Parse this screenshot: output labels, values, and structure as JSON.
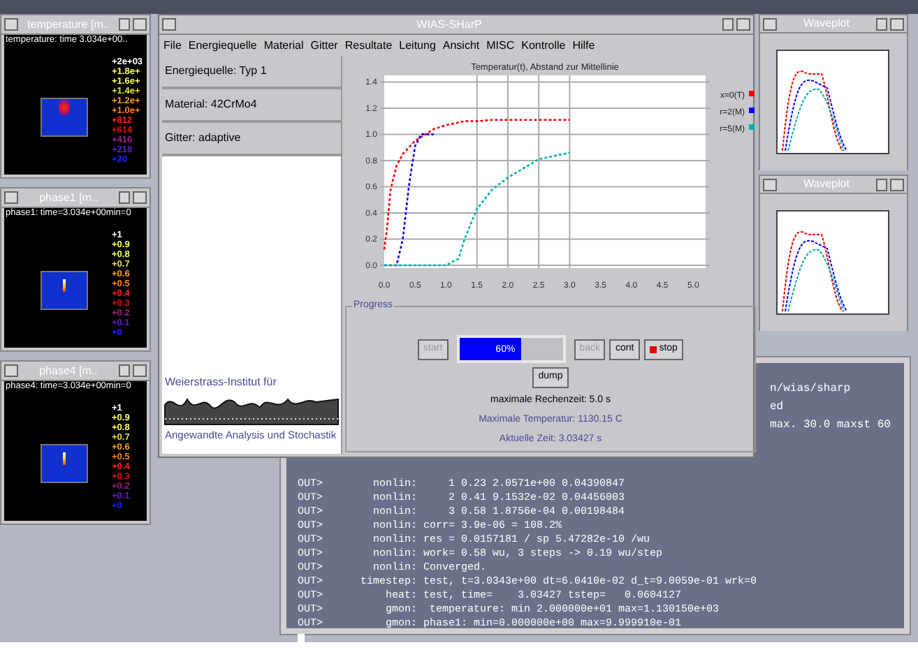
{
  "left_windows": [
    {
      "kind": "temperature",
      "title": "temperature [m..",
      "caption": "temperature: time 3.034e+00..",
      "legend": [
        {
          "label": "+2e+03",
          "color": "#ffffff"
        },
        {
          "label": "+1.8e+",
          "color": "#ffff60"
        },
        {
          "label": "+1.6e+",
          "color": "#ffff60"
        },
        {
          "label": "+1.4e+",
          "color": "#e0e040"
        },
        {
          "label": "+1.2e+",
          "color": "#ffa020"
        },
        {
          "label": "+1.0e+",
          "color": "#ff8020"
        },
        {
          "label": "+812",
          "color": "#ff2020"
        },
        {
          "label": "+614",
          "color": "#e01010"
        },
        {
          "label": "+416",
          "color": "#a02080"
        },
        {
          "label": "+218",
          "color": "#6020c0"
        },
        {
          "label": "+20",
          "color": "#2020ff"
        }
      ]
    },
    {
      "kind": "phase",
      "title": "phase1 [m..",
      "caption": "phase1: time=3.034e+00min=0",
      "legend": [
        {
          "label": "+1",
          "color": "#ffffff"
        },
        {
          "label": "+0.9",
          "color": "#ffff60"
        },
        {
          "label": "+0.8",
          "color": "#ffff60"
        },
        {
          "label": "+0.7",
          "color": "#e0e040"
        },
        {
          "label": "+0.6",
          "color": "#ffa020"
        },
        {
          "label": "+0.5",
          "color": "#ff8020"
        },
        {
          "label": "+0.4",
          "color": "#ff2020"
        },
        {
          "label": "+0.3",
          "color": "#e01010"
        },
        {
          "label": "+0.2",
          "color": "#a02080"
        },
        {
          "label": "+0.1",
          "color": "#6020c0"
        },
        {
          "label": "+0",
          "color": "#2020ff"
        }
      ]
    },
    {
      "kind": "phase",
      "title": "phase4 [m..",
      "caption": "phase4: time=3.034e+00min=0",
      "legend": [
        {
          "label": "+1",
          "color": "#ffffff"
        },
        {
          "label": "+0.9",
          "color": "#ffff60"
        },
        {
          "label": "+0.8",
          "color": "#ffff60"
        },
        {
          "label": "+0.7",
          "color": "#e0e040"
        },
        {
          "label": "+0.6",
          "color": "#ffa020"
        },
        {
          "label": "+0.5",
          "color": "#ff8020"
        },
        {
          "label": "+0.4",
          "color": "#ff2020"
        },
        {
          "label": "+0.3",
          "color": "#e01010"
        },
        {
          "label": "+0.2",
          "color": "#a02080"
        },
        {
          "label": "+0.1",
          "color": "#6020c0"
        },
        {
          "label": "+0",
          "color": "#2020ff"
        }
      ]
    }
  ],
  "terminal": {
    "partial_lines": [
      "n/wias/sharp",
      "ed",
      "max. 30.0 maxst 60"
    ],
    "lines": [
      "OUT>        nonlin:     1 0.23 2.0571e+00 0.04390847",
      "OUT>        nonlin:     2 0.41 9.1532e-02 0.04456003",
      "OUT>        nonlin:     3 0.58 1.8756e-04 0.00198484",
      "OUT>        nonlin: corr= 3.9e-06 = 108.2%",
      "OUT>        nonlin: res = 0.0157181 / sp 5.47282e-10 /wu",
      "OUT>        nonlin: work= 0.58 wu, 3 steps -> 0.19 wu/step",
      "OUT>        nonlin: Converged.",
      "OUT>      timestep: test, t=3.0343e+00 dt=6.0410e-02 d_t=9.0059e-01 wrk=0",
      "OUT>          heat: test, time=    3.03427 tstep=   0.0604127",
      "OUT>          gmon:  temperature: min 2.000000e+01 max=1.130150e+03",
      "OUT>          gmon: phase1: min=0.000000e+00 max=9.999910e-01"
    ]
  },
  "main_window": {
    "title": "WIAS-SHarP",
    "menu": [
      "File",
      "Energiequelle",
      "Material",
      "Gitter",
      "Resultate",
      "Leitung",
      "Ansicht",
      "MISC",
      "Kontrolle",
      "Hilfe"
    ],
    "info_fields": [
      "Energiequelle: Typ 1",
      "Material: 42CrMo4",
      "Gitter: adaptive"
    ],
    "logo": {
      "top_text": "Weierstrass-Institut für",
      "bottom_text": "Angewandte Analysis und Stochastik"
    },
    "chart_data": {
      "type": "line",
      "title": "Temperatur(t), Abstand zur Mittellinie",
      "xlim": [
        0,
        5.2
      ],
      "ylim": [
        0,
        1.45
      ],
      "xticks": [
        {
          "value": 0,
          "label": "0.0"
        },
        0.5,
        {
          "value": 1,
          "label": "1.0"
        },
        1.5,
        {
          "value": 2,
          "label": "2.0"
        },
        2.5,
        {
          "value": 3,
          "label": "3.0"
        },
        3.5,
        {
          "value": 4,
          "label": "4.0"
        },
        4.5,
        {
          "value": 5,
          "label": "5.0"
        }
      ],
      "grid": true,
      "legend": true,
      "yticks": [
        {
          "value": 0,
          "label": "0.0"
        },
        {
          "value": 0.2,
          "label": "0.2"
        },
        {
          "value": 0.4,
          "label": "0.4"
        },
        {
          "value": 0.6,
          "label": "0.6"
        },
        {
          "value": 0.8,
          "label": "0.8"
        },
        {
          "value": 1,
          "label": "1.0"
        },
        {
          "value": 1.2,
          "label": "1.2"
        },
        {
          "value": 1.4,
          "label": "1.4"
        }
      ],
      "x": [
        0,
        0.05,
        0.1,
        0.2,
        0.3,
        0.4,
        0.5,
        0.6,
        0.8,
        1.0,
        1.2,
        1.3,
        1.5,
        1.75,
        2.0,
        2.5,
        3.0
      ],
      "series": [
        {
          "name": "x=0(T)",
          "color": "#ff0000",
          "line_style": "dotted",
          "values": [
            0.12,
            0.3,
            0.57,
            0.76,
            0.85,
            0.9,
            0.95,
            0.98,
            1.04,
            1.07,
            1.09,
            1.1,
            1.1,
            1.11,
            1.11,
            1.11,
            1.11
          ]
        },
        {
          "name": "r=2(M)",
          "color": "#0000ff",
          "line_style": "dotted",
          "values": [
            0,
            0,
            0,
            0,
            0.2,
            0.61,
            0.91,
            1.0,
            1.0,
            null,
            null,
            null,
            null,
            null,
            null,
            null,
            null
          ]
        },
        {
          "name": "r=5(M)",
          "color": "#00b0b0",
          "line_style": "dotted",
          "values": [
            0,
            0,
            0,
            0,
            0,
            0,
            0,
            0,
            0,
            0,
            0.05,
            0.2,
            0.43,
            0.58,
            0.67,
            0.81,
            0.86
          ]
        }
      ]
    },
    "progress": {
      "group_label": "Progress",
      "level": 0.6,
      "percent": "60%",
      "buttons": [
        {
          "kind": "plain",
          "label": "start",
          "disabled": true
        },
        {
          "kind": "plain",
          "label": "back",
          "disabled": true
        },
        {
          "kind": "plain",
          "label": "cont",
          "disabled": false
        },
        {
          "kind": "stop",
          "label": "stop",
          "disabled": false
        }
      ],
      "dump_button": "dump",
      "info_lines": [
        {
          "kind": "plain",
          "text": "maximale Rechenzeit: 5.0 s"
        },
        {
          "kind": "accent",
          "text": "Maximale Temperatur: 1130.15 C"
        },
        {
          "kind": "accent",
          "text": "Aktuelle Zeit: 3.03427 s"
        }
      ]
    }
  },
  "right_windows": [
    {
      "title": "Waveplot"
    },
    {
      "title": "Waveplot"
    }
  ]
}
